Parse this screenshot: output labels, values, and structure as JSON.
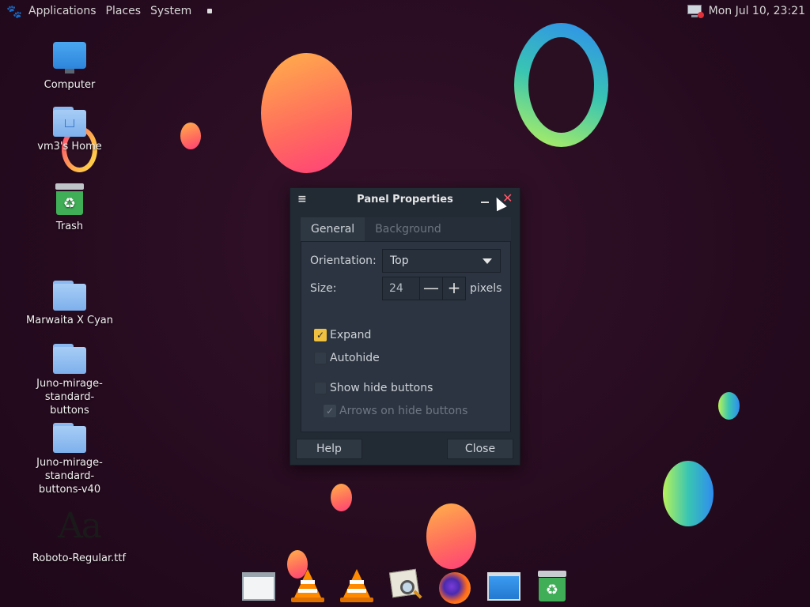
{
  "top_panel": {
    "menus": [
      "Applications",
      "Places",
      "System"
    ],
    "clock": "Mon Jul 10, 23:21"
  },
  "desktop_icons": [
    {
      "label": "Computer",
      "icon": "computer-icon"
    },
    {
      "label": "vm3's Home",
      "icon": "home-folder-icon"
    },
    {
      "label": "Trash",
      "icon": "trash-icon"
    },
    {
      "label": "Marwaita X Cyan",
      "icon": "folder-icon"
    },
    {
      "label": "Juno-mirage-standard-buttons",
      "icon": "folder-icon"
    },
    {
      "label": "Juno-mirage-standard-buttons-v40",
      "icon": "folder-icon"
    },
    {
      "label": "Roboto-Regular.ttf",
      "icon": "font-file-icon",
      "preview": "Aa"
    }
  ],
  "dialog": {
    "title": "Panel Properties",
    "tabs": [
      "General",
      "Background"
    ],
    "active_tab": "General",
    "orientation_label": "Orientation:",
    "orientation_value": "Top",
    "size_label": "Size:",
    "size_value": "24",
    "size_unit": "pixels",
    "minus": "—",
    "plus": "+",
    "expand_label": "Expand",
    "expand_checked": true,
    "autohide_label": "Autohide",
    "autohide_checked": false,
    "show_hide_label": "Show hide buttons",
    "show_hide_checked": false,
    "arrows_label": "Arrows on hide buttons",
    "arrows_checked": true,
    "arrows_enabled": false,
    "help_label": "Help",
    "close_label": "Close"
  },
  "dock": [
    "window-icon",
    "vlc-icon",
    "vlc-icon",
    "image-viewer-icon",
    "firefox-icon",
    "file-manager-icon",
    "trash-icon"
  ],
  "colors": {
    "background": "#2a0f22",
    "dialog": "#222a34",
    "accent_check": "#f0c040",
    "close_x": "#ff5a6a"
  }
}
